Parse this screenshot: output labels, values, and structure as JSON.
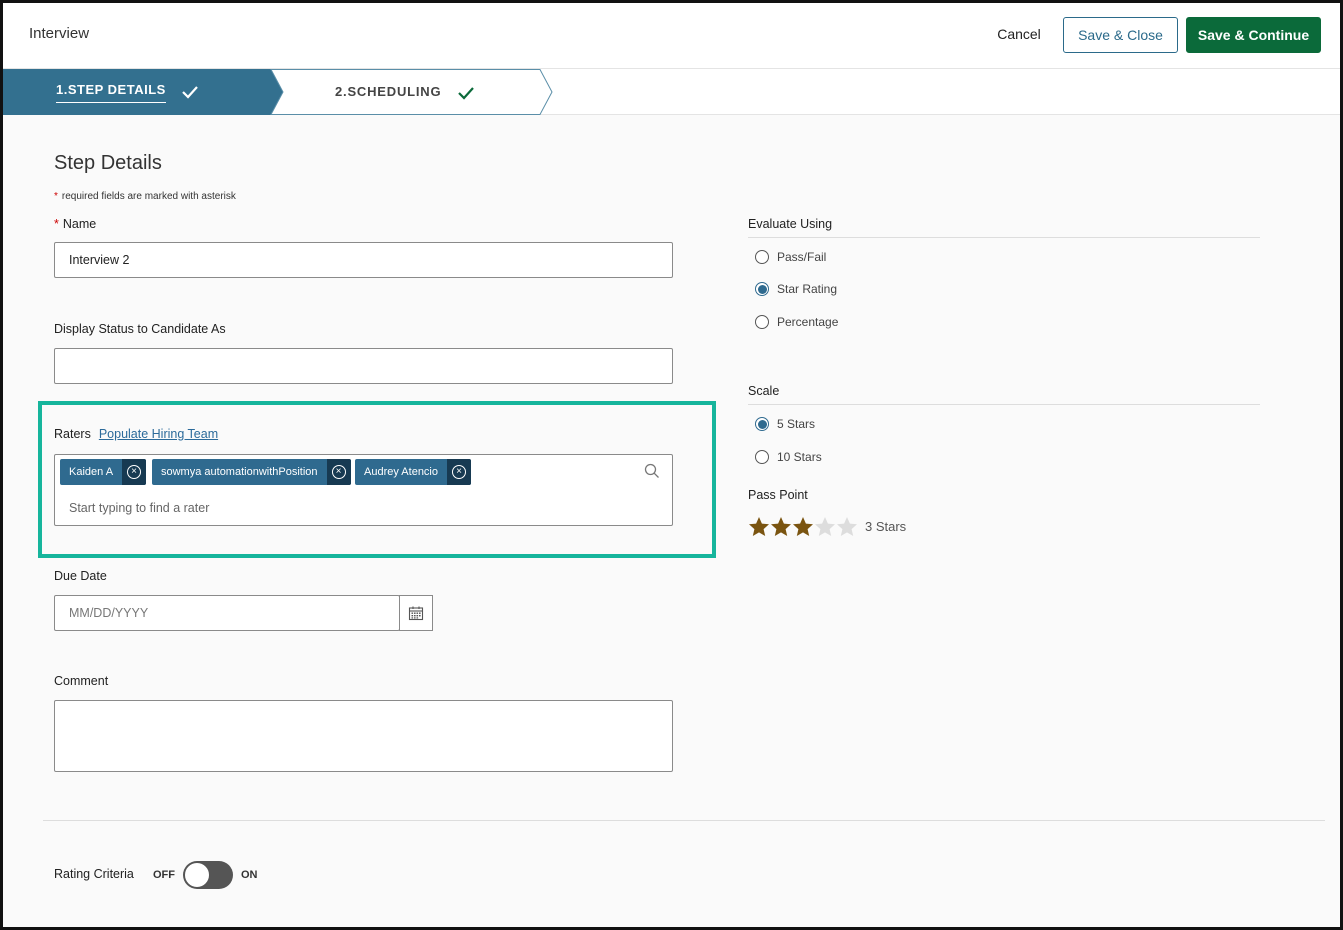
{
  "header": {
    "title": "Interview",
    "cancel_label": "Cancel",
    "save_close_label": "Save & Close",
    "save_continue_label": "Save & Continue"
  },
  "stepper": {
    "steps": [
      {
        "label": "1.STEP DETAILS",
        "active": true,
        "complete": true
      },
      {
        "label": "2.SCHEDULING",
        "active": false,
        "complete": true
      }
    ]
  },
  "form": {
    "heading": "Step Details",
    "required_asterisk": "*",
    "required_note": "required fields are marked with asterisk",
    "name_label": "Name",
    "name_value": "Interview 2",
    "display_status_label": "Display Status to Candidate As",
    "display_status_value": "",
    "raters_label": "Raters",
    "populate_link": "Populate Hiring Team",
    "raters": [
      "Kaiden A",
      "sowmya automationwithPosition",
      "Audrey Atencio"
    ],
    "rater_placeholder": "Start typing to find a rater",
    "due_date_label": "Due Date",
    "due_date_placeholder": "MM/DD/YYYY",
    "comment_label": "Comment",
    "comment_value": "",
    "rating_criteria_label": "Rating Criteria",
    "toggle_off": "OFF",
    "toggle_on": "ON",
    "rating_criteria_on": false
  },
  "evaluate": {
    "title": "Evaluate Using",
    "options": [
      "Pass/Fail",
      "Star Rating",
      "Percentage"
    ],
    "selected": "Star Rating"
  },
  "scale": {
    "title": "Scale",
    "options": [
      "5 Stars",
      "10 Stars"
    ],
    "selected": "5 Stars"
  },
  "pass_point": {
    "title": "Pass Point",
    "value": 3,
    "max": 5,
    "label": "3 Stars"
  },
  "colors": {
    "accent": "#2f6a8f",
    "primary_button": "#0b6a3a",
    "highlight": "#16b59c",
    "star_filled": "#7a5410",
    "star_empty": "#dddddd"
  }
}
